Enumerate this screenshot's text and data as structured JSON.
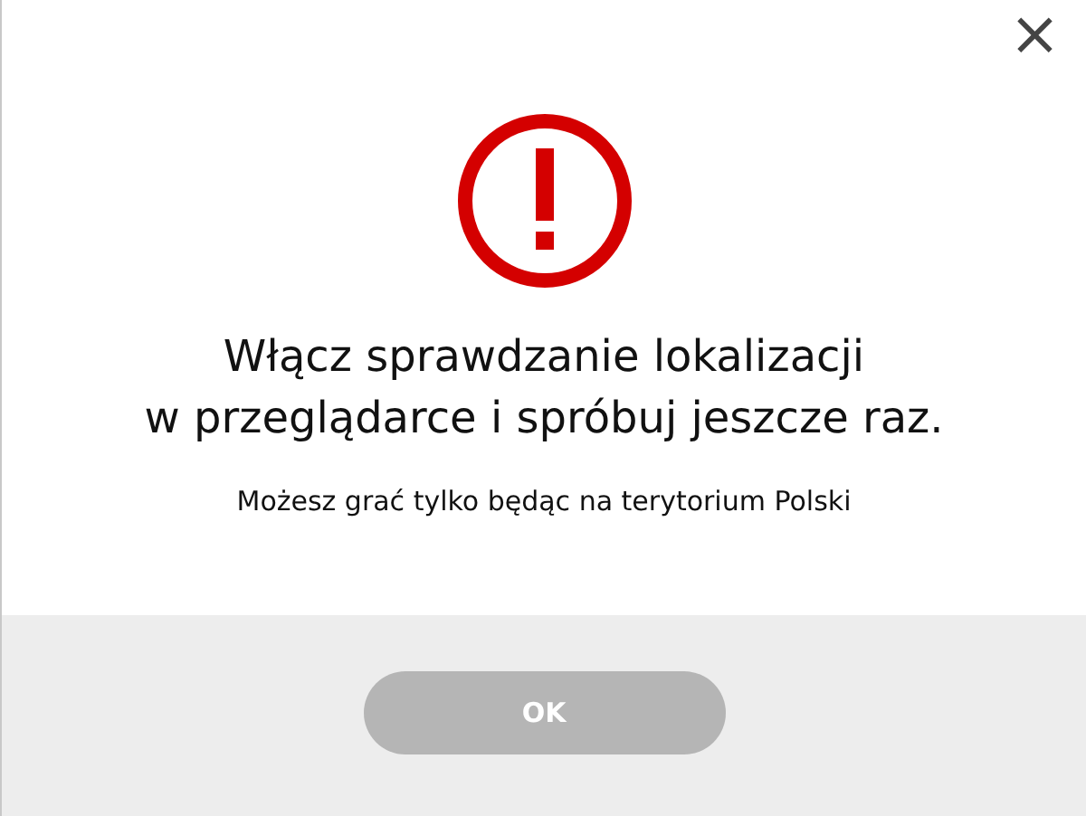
{
  "close": {
    "label": "×"
  },
  "title_lines": [
    "Włącz sprawdzanie lokalizacji",
    "w przeglądarce i spróbuj jeszcze raz."
  ],
  "message": "Możesz grać tylko będąc na terytorium Polski",
  "button": {
    "label": "OK",
    "disabled": true
  }
}
